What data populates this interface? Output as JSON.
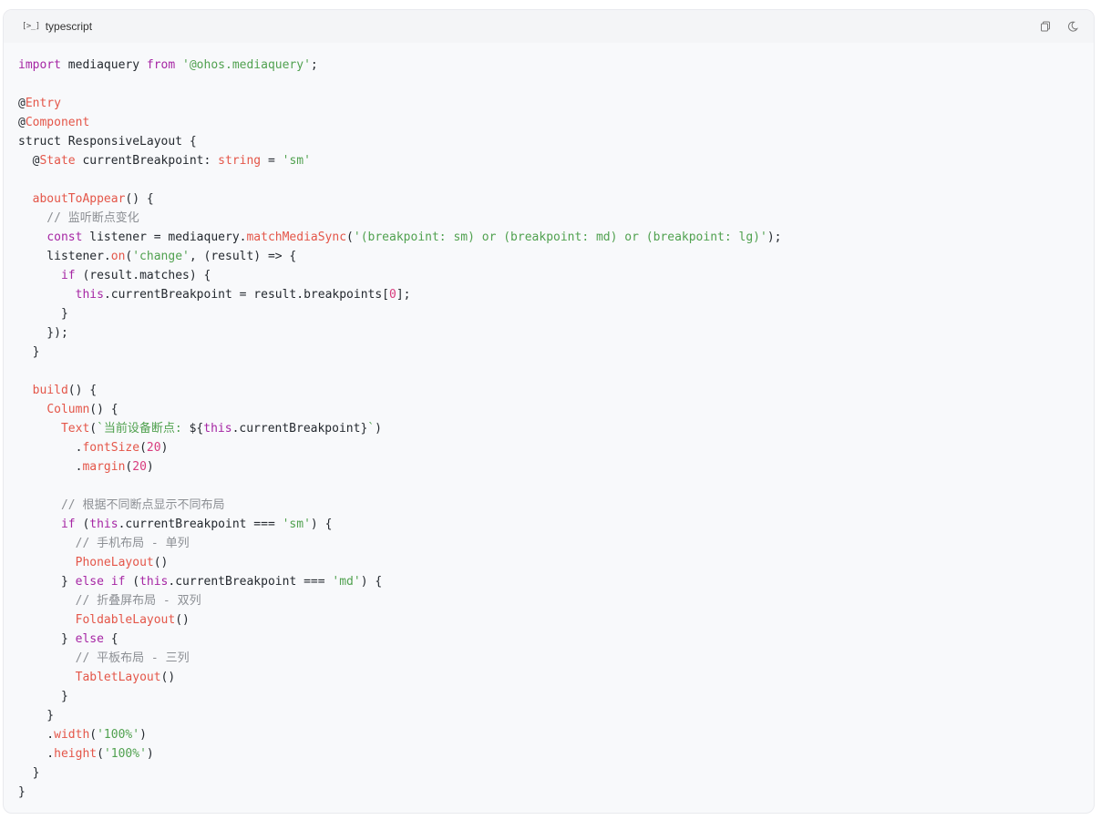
{
  "header": {
    "language_icon": "[>_]",
    "language": "typescript",
    "icons": [
      "copy-icon",
      "theme-toggle-icon"
    ]
  },
  "colors": {
    "keyword": "#a626a4",
    "string": "#50a14f",
    "function": "#e45649",
    "comment": "#8c8f94",
    "number": "#d83b7d",
    "default": "#24292f"
  },
  "code_lines": [
    [
      [
        "keyword",
        "import"
      ],
      [
        "default",
        " mediaquery "
      ],
      [
        "keyword",
        "from"
      ],
      [
        "default",
        " "
      ],
      [
        "string",
        "'@ohos.mediaquery'"
      ],
      [
        "default",
        ";"
      ]
    ],
    [],
    [
      [
        "default",
        "@"
      ],
      [
        "func",
        "Entry"
      ]
    ],
    [
      [
        "default",
        "@"
      ],
      [
        "func",
        "Component"
      ]
    ],
    [
      [
        "default",
        "struct ResponsiveLayout {"
      ]
    ],
    [
      [
        "default",
        "  @"
      ],
      [
        "func",
        "State"
      ],
      [
        "default",
        " currentBreakpoint: "
      ],
      [
        "func",
        "string"
      ],
      [
        "default",
        " = "
      ],
      [
        "string",
        "'sm'"
      ]
    ],
    [],
    [
      [
        "default",
        "  "
      ],
      [
        "func",
        "aboutToAppear"
      ],
      [
        "default",
        "() {"
      ]
    ],
    [
      [
        "comment",
        "    // 监听断点变化"
      ]
    ],
    [
      [
        "default",
        "    "
      ],
      [
        "keyword",
        "const"
      ],
      [
        "default",
        " listener = mediaquery."
      ],
      [
        "func",
        "matchMediaSync"
      ],
      [
        "default",
        "("
      ],
      [
        "string",
        "'(breakpoint: sm) or (breakpoint: md) or (breakpoint: lg)'"
      ],
      [
        "default",
        ");"
      ]
    ],
    [
      [
        "default",
        "    listener."
      ],
      [
        "func",
        "on"
      ],
      [
        "default",
        "("
      ],
      [
        "string",
        "'change'"
      ],
      [
        "default",
        ", (result) => {"
      ]
    ],
    [
      [
        "default",
        "      "
      ],
      [
        "keyword",
        "if"
      ],
      [
        "default",
        " (result.matches) {"
      ]
    ],
    [
      [
        "default",
        "        "
      ],
      [
        "keyword",
        "this"
      ],
      [
        "default",
        ".currentBreakpoint = result.breakpoints["
      ],
      [
        "number",
        "0"
      ],
      [
        "default",
        "];"
      ]
    ],
    [
      [
        "default",
        "      }"
      ]
    ],
    [
      [
        "default",
        "    });"
      ]
    ],
    [
      [
        "default",
        "  }"
      ]
    ],
    [],
    [
      [
        "default",
        "  "
      ],
      [
        "func",
        "build"
      ],
      [
        "default",
        "() {"
      ]
    ],
    [
      [
        "default",
        "    "
      ],
      [
        "func",
        "Column"
      ],
      [
        "default",
        "() {"
      ]
    ],
    [
      [
        "default",
        "      "
      ],
      [
        "func",
        "Text"
      ],
      [
        "default",
        "("
      ],
      [
        "string",
        "`当前设备断点: "
      ],
      [
        "default",
        "${"
      ],
      [
        "keyword",
        "this"
      ],
      [
        "default",
        ".currentBreakpoint}"
      ],
      [
        "string",
        "`"
      ],
      [
        "default",
        ")"
      ]
    ],
    [
      [
        "default",
        "        ."
      ],
      [
        "func",
        "fontSize"
      ],
      [
        "default",
        "("
      ],
      [
        "number",
        "20"
      ],
      [
        "default",
        ")"
      ]
    ],
    [
      [
        "default",
        "        ."
      ],
      [
        "func",
        "margin"
      ],
      [
        "default",
        "("
      ],
      [
        "number",
        "20"
      ],
      [
        "default",
        ")"
      ]
    ],
    [],
    [
      [
        "comment",
        "      // 根据不同断点显示不同布局"
      ]
    ],
    [
      [
        "default",
        "      "
      ],
      [
        "keyword",
        "if"
      ],
      [
        "default",
        " ("
      ],
      [
        "keyword",
        "this"
      ],
      [
        "default",
        ".currentBreakpoint === "
      ],
      [
        "string",
        "'sm'"
      ],
      [
        "default",
        ") {"
      ]
    ],
    [
      [
        "comment",
        "        // 手机布局 - 单列"
      ]
    ],
    [
      [
        "default",
        "        "
      ],
      [
        "func",
        "PhoneLayout"
      ],
      [
        "default",
        "()"
      ]
    ],
    [
      [
        "default",
        "      } "
      ],
      [
        "keyword",
        "else"
      ],
      [
        "default",
        " "
      ],
      [
        "keyword",
        "if"
      ],
      [
        "default",
        " ("
      ],
      [
        "keyword",
        "this"
      ],
      [
        "default",
        ".currentBreakpoint === "
      ],
      [
        "string",
        "'md'"
      ],
      [
        "default",
        ") {"
      ]
    ],
    [
      [
        "comment",
        "        // 折叠屏布局 - 双列"
      ]
    ],
    [
      [
        "default",
        "        "
      ],
      [
        "func",
        "FoldableLayout"
      ],
      [
        "default",
        "()"
      ]
    ],
    [
      [
        "default",
        "      } "
      ],
      [
        "keyword",
        "else"
      ],
      [
        "default",
        " {"
      ]
    ],
    [
      [
        "comment",
        "        // 平板布局 - 三列"
      ]
    ],
    [
      [
        "default",
        "        "
      ],
      [
        "func",
        "TabletLayout"
      ],
      [
        "default",
        "()"
      ]
    ],
    [
      [
        "default",
        "      }"
      ]
    ],
    [
      [
        "default",
        "    }"
      ]
    ],
    [
      [
        "default",
        "    ."
      ],
      [
        "func",
        "width"
      ],
      [
        "default",
        "("
      ],
      [
        "string",
        "'100%'"
      ],
      [
        "default",
        ")"
      ]
    ],
    [
      [
        "default",
        "    ."
      ],
      [
        "func",
        "height"
      ],
      [
        "default",
        "("
      ],
      [
        "string",
        "'100%'"
      ],
      [
        "default",
        ")"
      ]
    ],
    [
      [
        "default",
        "  }"
      ]
    ],
    [
      [
        "default",
        "}"
      ]
    ]
  ]
}
